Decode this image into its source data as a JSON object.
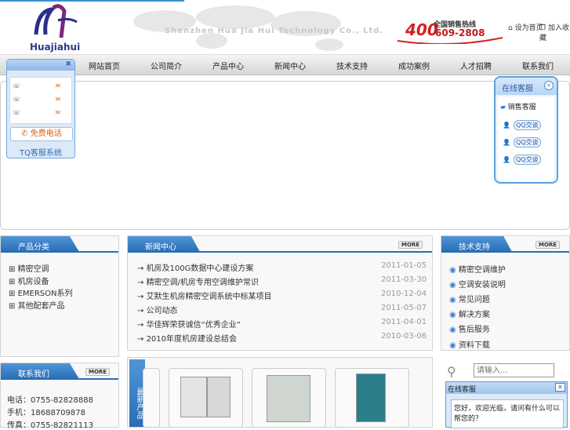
{
  "header": {
    "logo_text": "Huajiahui",
    "company_en": "Shenzhen Hua Jia Hui Technology Co., Ltd.",
    "hotline_prefix": "400",
    "hotline_caption": "全国销售热线",
    "hotline_number": "609-2808",
    "links": [
      "设为首页",
      "加入收藏"
    ]
  },
  "nav": {
    "items": [
      "网站首页",
      "公司简介",
      "产品中心",
      "新闻中心",
      "技术支持",
      "成功案例",
      "人才招聘",
      "联系我们"
    ]
  },
  "tq": {
    "call_label": "免费电话",
    "system_label": "TQ客服系统"
  },
  "online_service": {
    "title": "在线客服",
    "group": "销售客服",
    "chat_label": "QQ交谈"
  },
  "products_panel": {
    "title": "产品分类",
    "items": [
      "精密空调",
      "机房设备",
      "EMERSON系列",
      "其他配套产品"
    ]
  },
  "news_panel": {
    "title": "新闻中心",
    "more": "MORE",
    "items": [
      {
        "title": "机房及100G数据中心建设方案",
        "date": "2011-01-05"
      },
      {
        "title": "精密空调/机房专用空调维护常识",
        "date": "2011-03-30"
      },
      {
        "title": "艾默生机房精密空调系统中标某项目",
        "date": "2010-12-04"
      },
      {
        "title": "公司动态",
        "date": "2011-05-07"
      },
      {
        "title": "华佳辉荣获诚信“优秀企业”",
        "date": "2011-04-01"
      },
      {
        "title": "2010年度机房建设总结会",
        "date": "2010-03-06"
      }
    ]
  },
  "support_panel": {
    "title": "技术支持",
    "more": "MORE",
    "items": [
      "精密空调维护",
      "空调安装说明",
      "常见问题",
      "解决方案",
      "售后服务",
      "资料下载"
    ]
  },
  "contact_panel": {
    "title": "联系我们",
    "more": "MORE",
    "lines": [
      "电话：0755-82828888",
      "手机：18688709878",
      "传真：0755-82821113"
    ]
  },
  "new_products": {
    "label": "最新产品"
  },
  "search": {
    "placeholder": "请输入..."
  },
  "chat_popup": {
    "title": "在线客服",
    "message": "您好，欢迎光临，请问有什么可以帮您的？"
  }
}
